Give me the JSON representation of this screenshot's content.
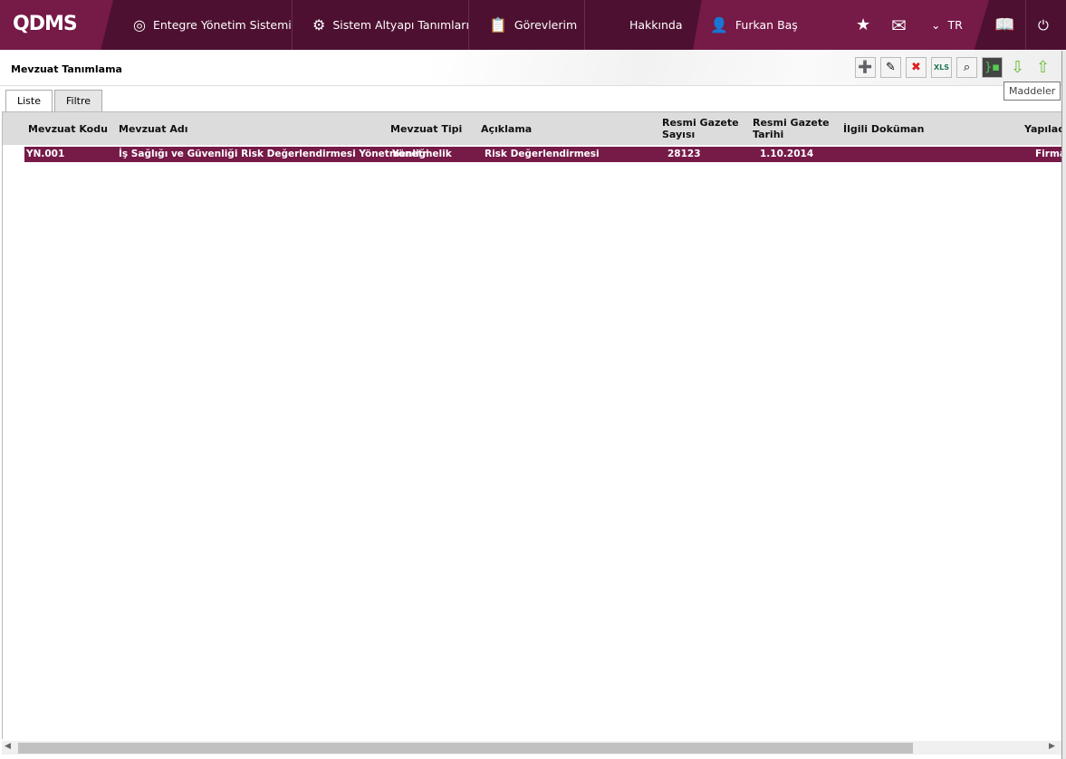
{
  "header": {
    "logo": "QDMS",
    "nav": [
      {
        "label": "Entegre Yönetim Sistemi",
        "icon": "q-logo-icon"
      },
      {
        "label": "Sistem Altyapı Tanımları",
        "icon": "gear-icon"
      },
      {
        "label": "Görevlerim",
        "icon": "clipboard-icon"
      },
      {
        "label": "Hakkında"
      }
    ],
    "user": "Furkan Baş",
    "language": "TR",
    "colors": {
      "bar": "#4d1030",
      "accent": "#761a48"
    }
  },
  "page": {
    "title": "Mevzuat Tanımlama",
    "tooltip": "Maddeler"
  },
  "tabs": [
    "Liste",
    "Filtre"
  ],
  "table": {
    "columns": [
      "Mevzuat Kodu",
      "Mevzuat Adı",
      "Mevzuat Tipi",
      "Açıklama",
      "Resmi Gazete Sayısı",
      "Resmi Gazete Tarihi",
      "İlgili Doküman",
      "Yapılac"
    ],
    "rows": [
      {
        "kod": "YN.001",
        "ad": "İş Sağlığı ve Güvenliği Risk Değerlendirmesi Yönetmenliği",
        "tip": "Yönetmelik",
        "aciklama": "Risk Değerlendirmesi",
        "sayi": "28123",
        "tarih": "1.10.2014",
        "dokuman": "",
        "yapilacak": "Firma"
      }
    ]
  }
}
